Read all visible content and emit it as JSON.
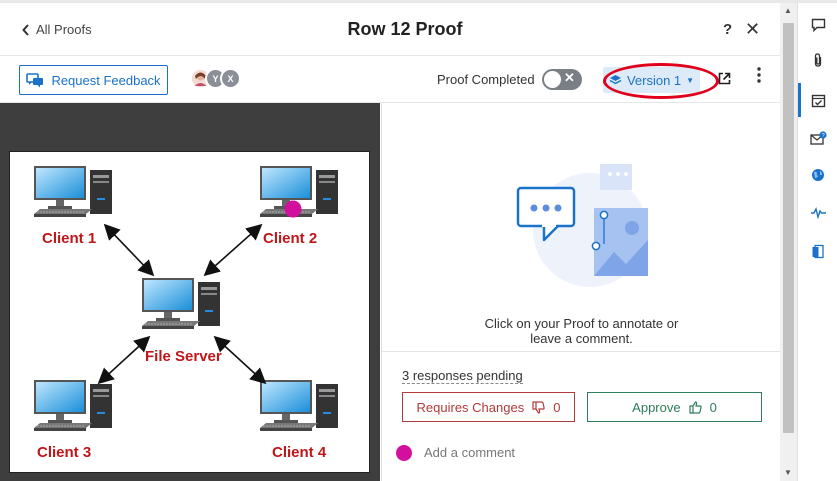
{
  "header": {
    "back_label": "All Proofs",
    "title": "Row 12 Proof",
    "help": "?",
    "close": "✕"
  },
  "toolbar": {
    "request_feedback_label": "Request Feedback",
    "avatars": [
      "",
      "Y",
      "X"
    ],
    "proof_completed_label": "Proof Completed",
    "proof_completed": false,
    "version_label": "Version 1",
    "more": "⋮"
  },
  "proof_image": {
    "labels": {
      "client1": "Client 1",
      "client2": "Client 2",
      "client3": "Client 3",
      "client4": "Client 4",
      "server": "File Server"
    }
  },
  "panel": {
    "prompt_line1": "Click on your Proof to annotate or",
    "prompt_line2": "leave a comment.",
    "pending": "3 responses pending",
    "requires_changes_label": "Requires Changes",
    "requires_changes_count": "0",
    "approve_label": "Approve",
    "approve_count": "0",
    "comment_placeholder": "Add a comment"
  },
  "colors": {
    "accent": "#1b73c9",
    "reject": "#b33a3a",
    "approve": "#2e7d5b",
    "annotation": "#d3109e",
    "highlight": "#e0001b"
  },
  "rail_icons": [
    "comment-icon",
    "attachment-icon",
    "proof-check-icon",
    "email-help-icon",
    "globe-icon",
    "activity-icon",
    "book-icon"
  ]
}
